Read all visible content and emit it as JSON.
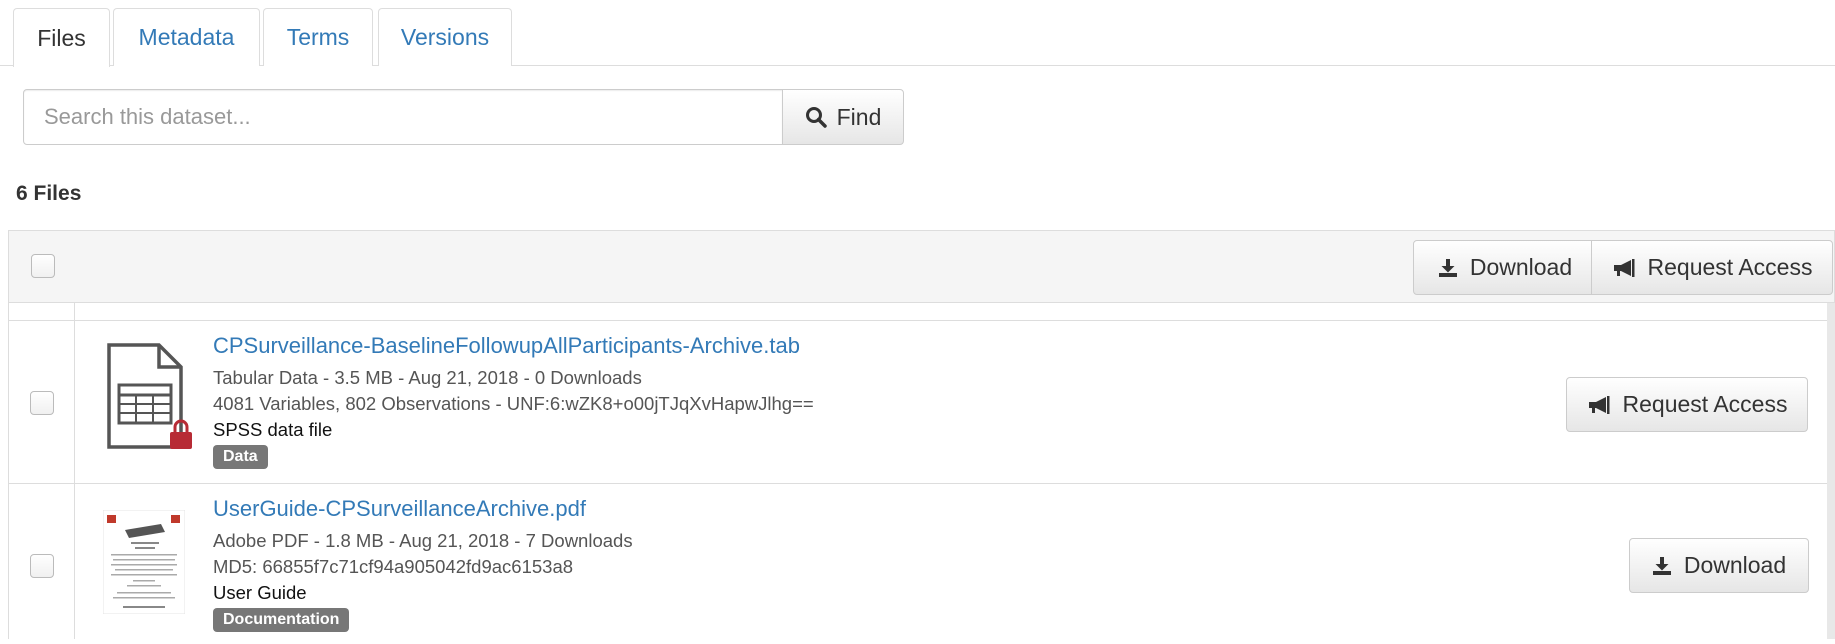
{
  "tabs": [
    {
      "label": "Files",
      "active": true
    },
    {
      "label": "Metadata"
    },
    {
      "label": "Terms"
    },
    {
      "label": "Versions"
    }
  ],
  "search": {
    "placeholder": "Search this dataset...",
    "value": "",
    "button_label": "Find",
    "icon": "search-icon"
  },
  "file_count": "6 Files",
  "header_actions": {
    "download_label": "Download",
    "request_access_label": "Request Access"
  },
  "files": [
    {
      "name": "CPSurveillance-BaselineFollowupAllParticipants-Archive.tab",
      "meta_line1": "Tabular Data - 3.5 MB - Aug 21, 2018 - 0 Downloads",
      "meta_line2": "4081 Variables, 802 Observations - UNF:6:wZK8+o00jTJqXvHapwJlhg==",
      "description": "SPSS data file",
      "tag": "Data",
      "action_label": "Request Access",
      "icon": "tabular-file-locked-icon"
    },
    {
      "name": "UserGuide-CPSurveillanceArchive.pdf",
      "meta_line1": "Adobe PDF - 1.8 MB - Aug 21, 2018 - 7 Downloads",
      "meta_line2": "MD5: 66855f7c71cf94a905042fd9ac6153a8",
      "description": "User Guide",
      "tag": "Documentation",
      "action_label": "Download",
      "icon": "pdf-thumbnail"
    }
  ],
  "colors": {
    "link": "#337ab7",
    "label_bg": "#777777",
    "lock": "#b72b35",
    "border": "#dddddd"
  }
}
